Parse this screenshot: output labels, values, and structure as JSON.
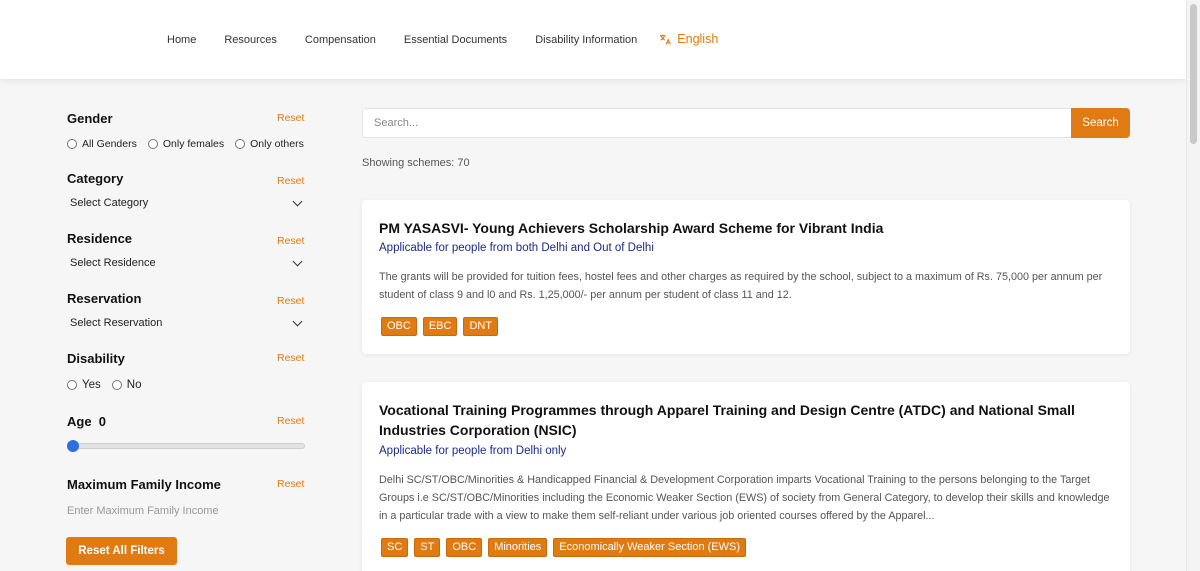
{
  "nav": {
    "items": [
      "Home",
      "Resources",
      "Compensation",
      "Essential Documents",
      "Disability Information"
    ],
    "language": "English"
  },
  "filters": {
    "gender": {
      "title": "Gender",
      "reset": "Reset",
      "options": [
        "All Genders",
        "Only females",
        "Only others"
      ]
    },
    "category": {
      "title": "Category",
      "reset": "Reset",
      "selected": "Select Category"
    },
    "residence": {
      "title": "Residence",
      "reset": "Reset",
      "selected": "Select Residence"
    },
    "reservation": {
      "title": "Reservation",
      "reset": "Reset",
      "selected": "Select Reservation"
    },
    "disability": {
      "title": "Disability",
      "reset": "Reset",
      "options": [
        "Yes",
        "No"
      ]
    },
    "age": {
      "title": "Age",
      "value": "0",
      "reset": "Reset",
      "slider_fraction": 0
    },
    "income": {
      "title": "Maximum Family Income",
      "reset": "Reset",
      "placeholder": "Enter Maximum Family Income"
    },
    "reset_all": "Reset All Filters"
  },
  "search": {
    "placeholder": "Search...",
    "button": "Search"
  },
  "showing": "Showing schemes: 70",
  "schemes": [
    {
      "title": "PM YASASVI- Young Achievers Scholarship Award Scheme for Vibrant India",
      "applicable": "Applicable for people from both Delhi and Out of Delhi",
      "description": "The grants will be provided for tuition fees, hostel fees and other charges as required by the school, subject to a maximum of Rs. 75,000 per annum per student of class 9 and l0 and Rs. 1,25,000/- per annum per student of class 11 and 12.",
      "tags": [
        "OBC",
        "EBC",
        "DNT"
      ]
    },
    {
      "title": "Vocational Training Programmes through Apparel Training and Design Centre (ATDC) and National Small Industries Corporation (NSIC)",
      "applicable": "Applicable for people from Delhi only",
      "description": "Delhi SC/ST/OBC/Minorities & Handicapped Financial & Development Corporation imparts Vocational Training to the persons belonging to the Target Groups i.e SC/ST/OBC/Minorities including the Economic Weaker Section (EWS) of society from General Category, to develop their skills and knowledge in a particular trade with a view to make them self-reliant under various job oriented courses offered by the Apparel...",
      "tags": [
        "SC",
        "ST",
        "OBC",
        "Minorities",
        "Economically Weaker Section (EWS)"
      ]
    }
  ],
  "colors": {
    "accent": "#e07a12",
    "link": "#1a2a8a",
    "slider_knob": "#2d6fe0"
  }
}
